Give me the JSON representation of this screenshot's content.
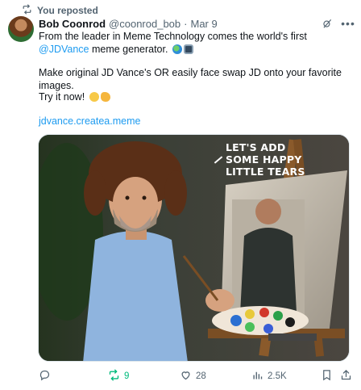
{
  "repost_banner": {
    "label": "You reposted"
  },
  "tweet": {
    "author_name": "Bob Coonrod",
    "handle": "@coonrod_bob",
    "separator": "·",
    "date": "Mar 9",
    "text_line1_prefix": "From the leader in Meme Technology comes the world's first ",
    "mention": "@JDVance",
    "text_line1_suffix": " meme generator.",
    "text_line2": "Make original JD Vance's OR easily face swap JD onto your favorite images.",
    "text_line3": "Try it now!",
    "link": "jdvance.createa.meme",
    "image_caption": "LET'S ADD SOME HAPPY LITTLE TEARS"
  },
  "actions": {
    "reply_count": "",
    "repost_count": "9",
    "like_count": "28",
    "views_count": "2.5K"
  },
  "icons": {
    "repost_banner": "repost-icon",
    "grok": "grok-icon",
    "more": "more-icon",
    "reply": "reply-icon",
    "repost": "repost-icon",
    "like": "heart-icon",
    "views": "views-icon",
    "bookmark": "bookmark-icon",
    "share": "share-icon"
  },
  "colors": {
    "link": "#1d9bf0",
    "muted": "#536471",
    "reposted_green": "#00ba7c",
    "text": "#0f1419"
  }
}
